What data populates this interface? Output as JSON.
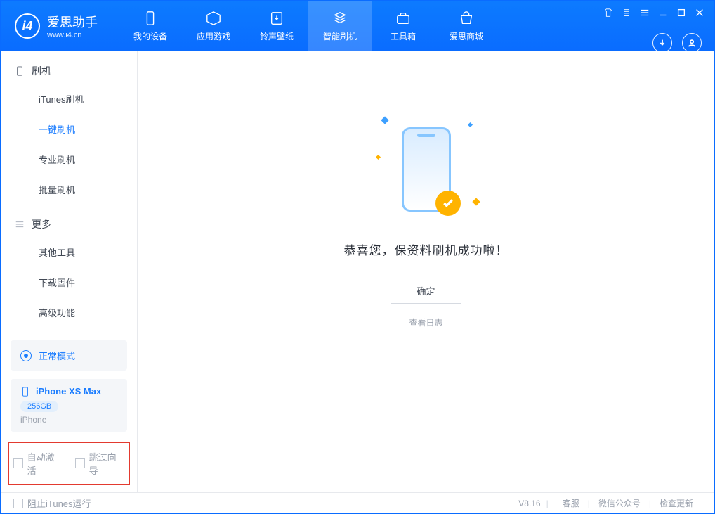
{
  "app": {
    "name": "爱思助手",
    "url": "www.i4.cn"
  },
  "header_tabs": [
    {
      "label": "我的设备"
    },
    {
      "label": "应用游戏"
    },
    {
      "label": "铃声壁纸"
    },
    {
      "label": "智能刷机"
    },
    {
      "label": "工具箱"
    },
    {
      "label": "爱思商城"
    }
  ],
  "sidebar": {
    "group1": "刷机",
    "items1": [
      "iTunes刷机",
      "一键刷机",
      "专业刷机",
      "批量刷机"
    ],
    "group2": "更多",
    "items2": [
      "其他工具",
      "下载固件",
      "高级功能"
    ]
  },
  "device_mode": "正常模式",
  "device": {
    "name": "iPhone XS Max",
    "storage": "256GB",
    "type": "iPhone"
  },
  "checkboxes": {
    "auto_activate": "自动激活",
    "skip_guide": "跳过向导"
  },
  "main": {
    "success_msg": "恭喜您，保资料刷机成功啦！",
    "confirm": "确定",
    "view_log": "查看日志"
  },
  "footer": {
    "block_itunes": "阻止iTunes运行",
    "version": "V8.16",
    "links": [
      "客服",
      "微信公众号",
      "检查更新"
    ]
  }
}
